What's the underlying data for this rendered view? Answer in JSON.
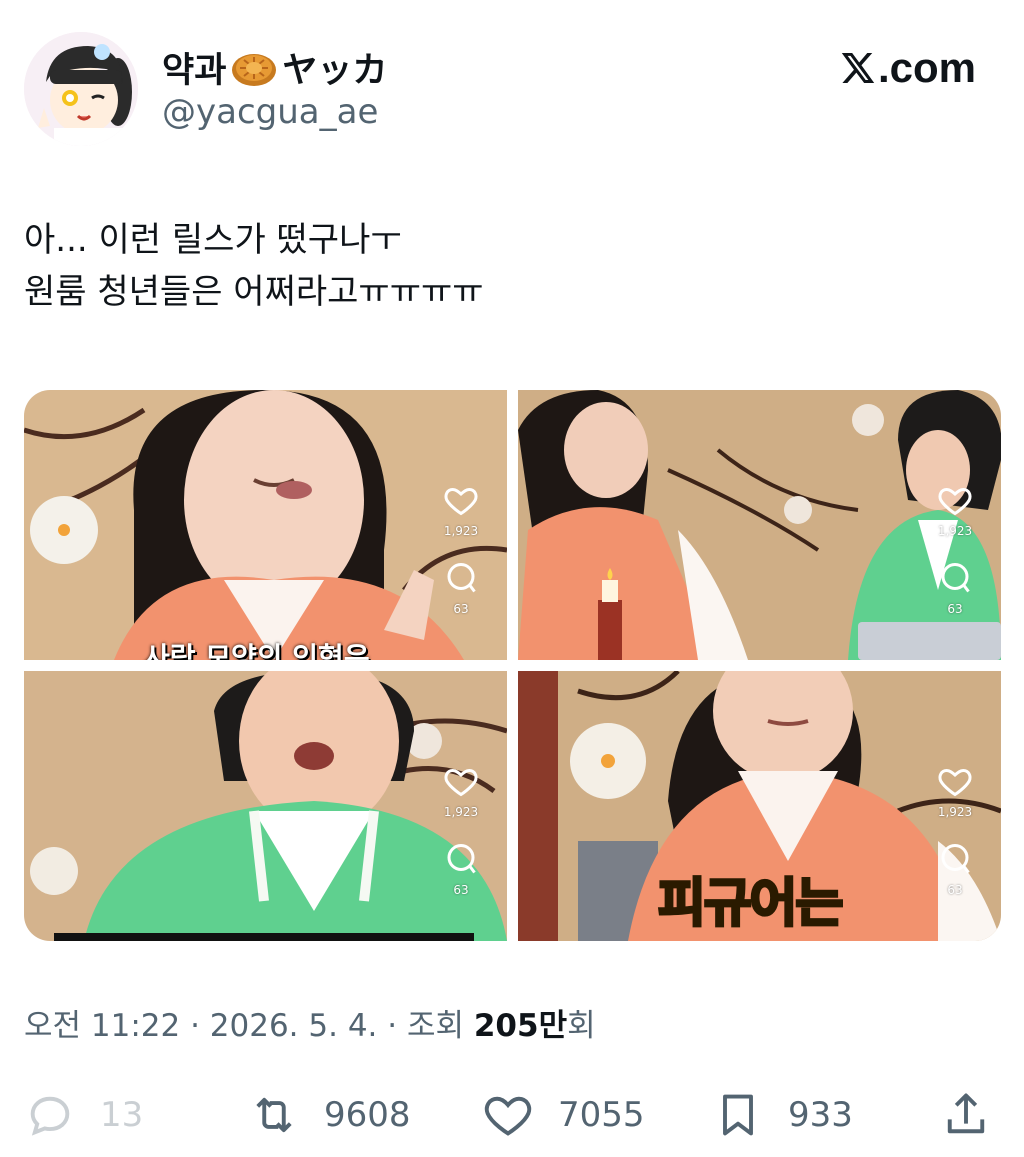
{
  "author": {
    "display_name_prefix": "약과",
    "display_name_emoji": "mooncake-emoji",
    "display_name_suffix": "ヤッカ",
    "handle": "@yacgua_ae"
  },
  "brand": {
    "label": ".com",
    "logo_icon": "x-logo-icon"
  },
  "tweet": {
    "lines": [
      "아... 이런 릴스가 떴구나ㅜ",
      "원룸 청년들은 어쩌라고ㅠㅠㅠㅠ"
    ]
  },
  "media": [
    {
      "likes": "1,923",
      "comments": "63",
      "caption": "사람 모양의 인형은"
    },
    {
      "likes": "1,923",
      "comments": "63"
    },
    {
      "likes": "1,923",
      "comments": "63"
    },
    {
      "likes": "1,923",
      "comments": "63",
      "caption": "피규어는"
    }
  ],
  "meta": {
    "prefix": "오전 11:22 · 2026. 5. 4. · 조회 ",
    "views_bold": "205만",
    "suffix": "회"
  },
  "actions": {
    "replies": "13",
    "retweets": "9608",
    "likes": "7055",
    "bookmarks": "933"
  },
  "colors": {
    "text_primary": "#0f1419",
    "text_secondary": "#536471",
    "hanbok_pink": "#f2926e",
    "hanbok_green": "#5fd08f"
  }
}
